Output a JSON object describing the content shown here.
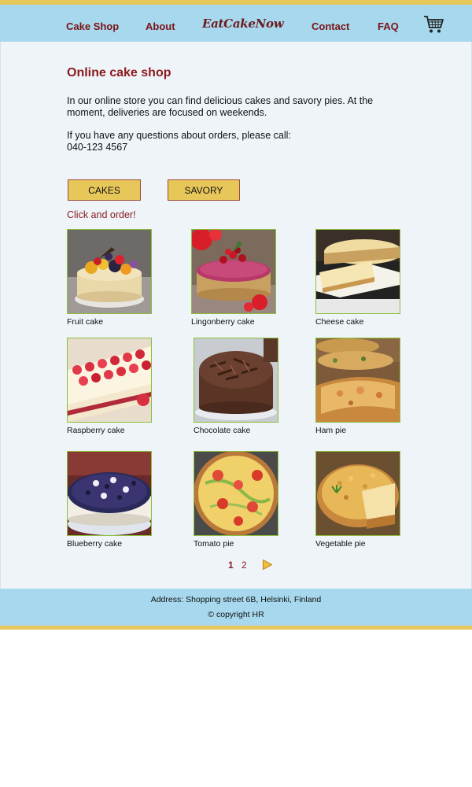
{
  "nav": {
    "items": [
      {
        "label": "Cake Shop"
      },
      {
        "label": "About"
      },
      {
        "label": "Contact"
      },
      {
        "label": "FAQ"
      }
    ],
    "logo": "EatCakeNow",
    "cart_icon": "shopping-cart-icon"
  },
  "content": {
    "heading": "Online cake shop",
    "intro": "In our online store you can find delicious cakes and savory pies. At the moment, deliveries are focused on weekends.",
    "question": "If you have any questions about orders, please call:",
    "phone": "040-123 4567",
    "buttons": {
      "cakes": "CAKES",
      "savory": "SAVORY"
    },
    "click_order": "Click and order!"
  },
  "products": [
    {
      "name": "Fruit  cake"
    },
    {
      "name": "Lingonberry cake"
    },
    {
      "name": "Cheese cake"
    },
    {
      "name": "Raspberry cake"
    },
    {
      "name": "Chocolate cake"
    },
    {
      "name": "Ham pie"
    },
    {
      "name": "Blueberry cake"
    },
    {
      "name": "Tomato pie"
    },
    {
      "name": "Vegetable pie"
    }
  ],
  "pagination": {
    "pages": [
      "1",
      "2"
    ],
    "current": "1",
    "next_icon": "play-arrow-icon"
  },
  "footer": {
    "address": "Address: Shopping street 6B, Helsinki, Finland",
    "copyright": "© copyright HR"
  },
  "colors": {
    "nav_bg": "#a8d8ed",
    "accent_stripe": "#e5c75a",
    "brand_red": "#8b1a1e",
    "button_bg": "#e8c75a",
    "page_bg": "#eef4f8",
    "thumb_border": "#8cbf3a"
  }
}
